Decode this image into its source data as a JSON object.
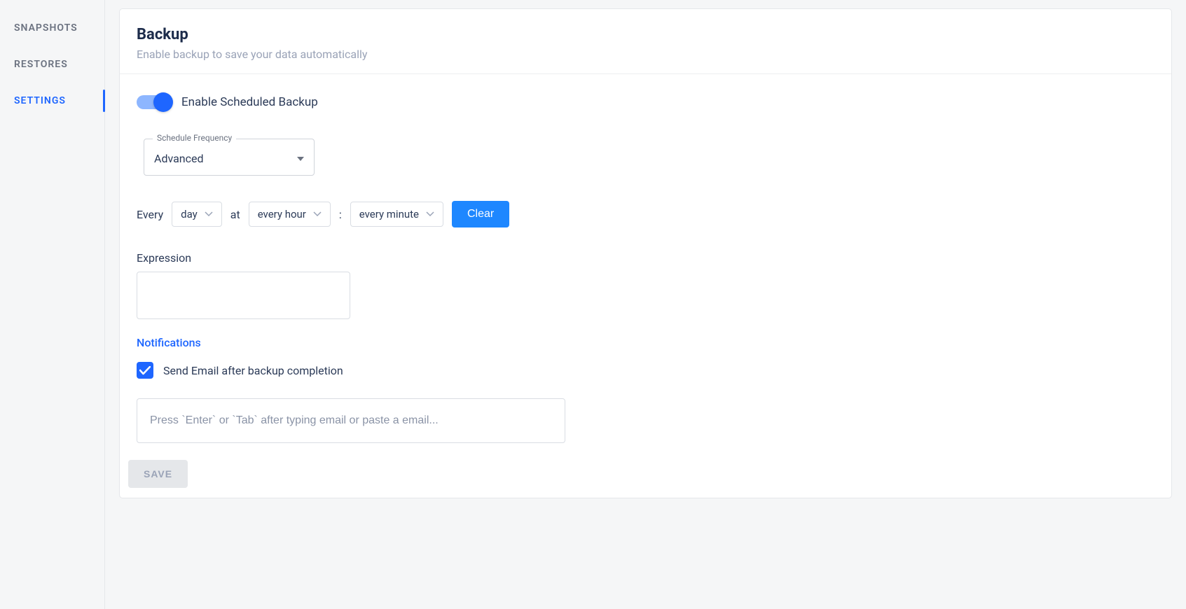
{
  "sidebar": {
    "items": [
      {
        "label": "SNAPSHOTS"
      },
      {
        "label": "RESTORES"
      },
      {
        "label": "SETTINGS"
      }
    ]
  },
  "page": {
    "title": "Backup",
    "subtitle": "Enable backup to save your data automatically"
  },
  "toggle": {
    "label": "Enable Scheduled Backup",
    "on": true
  },
  "frequency": {
    "label": "Schedule Frequency",
    "value": "Advanced"
  },
  "schedule": {
    "every_label": "Every",
    "day_value": "day",
    "at_label": "at",
    "hour_value": "every hour",
    "minute_value": "every minute",
    "clear_label": "Clear"
  },
  "expression": {
    "label": "Expression",
    "value": ""
  },
  "notifications": {
    "heading": "Notifications",
    "checkbox_label": "Send Email after backup completion",
    "checked": true,
    "email_placeholder": "Press `Enter` or `Tab` after typing email or paste a email..."
  },
  "footer": {
    "save_label": "SAVE"
  }
}
